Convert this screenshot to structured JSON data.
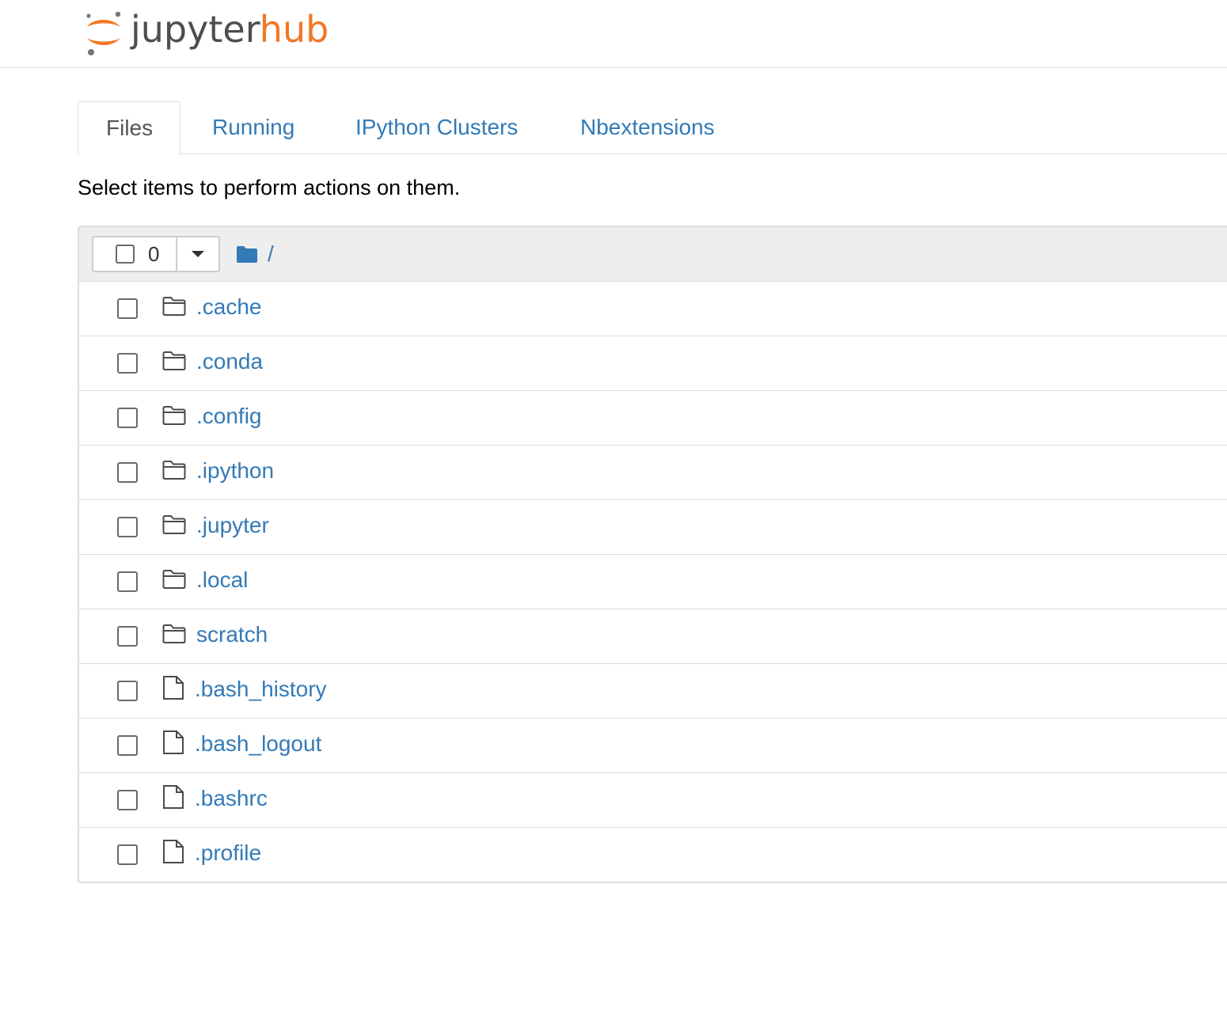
{
  "header": {
    "logo": {
      "word_jupyter": "jupyter",
      "word_hub": "hub"
    }
  },
  "tabs": [
    {
      "label": "Files",
      "active": true
    },
    {
      "label": "Running",
      "active": false
    },
    {
      "label": "IPython Clusters",
      "active": false
    },
    {
      "label": "Nbextensions",
      "active": false
    }
  ],
  "instructions": "Select items to perform actions on them.",
  "list_header": {
    "selected_count": "0",
    "breadcrumb_icon": "folder-solid-icon",
    "breadcrumb_path": "/"
  },
  "items": [
    {
      "name": ".cache",
      "type": "folder",
      "icon": "folder-outline-icon"
    },
    {
      "name": ".conda",
      "type": "folder",
      "icon": "folder-outline-icon"
    },
    {
      "name": ".config",
      "type": "folder",
      "icon": "folder-outline-icon"
    },
    {
      "name": ".ipython",
      "type": "folder",
      "icon": "folder-outline-icon"
    },
    {
      "name": ".jupyter",
      "type": "folder",
      "icon": "folder-outline-icon"
    },
    {
      "name": ".local",
      "type": "folder",
      "icon": "folder-outline-icon"
    },
    {
      "name": "scratch",
      "type": "folder",
      "icon": "folder-outline-icon"
    },
    {
      "name": ".bash_history",
      "type": "file",
      "icon": "file-outline-icon"
    },
    {
      "name": ".bash_logout",
      "type": "file",
      "icon": "file-outline-icon"
    },
    {
      "name": ".bashrc",
      "type": "file",
      "icon": "file-outline-icon"
    },
    {
      "name": ".profile",
      "type": "file",
      "icon": "file-outline-icon"
    }
  ],
  "colors": {
    "link": "#337ab7",
    "brand_orange": "#f37726",
    "brand_gray": "#4e4e4e",
    "header_bg": "#eeeeee"
  }
}
